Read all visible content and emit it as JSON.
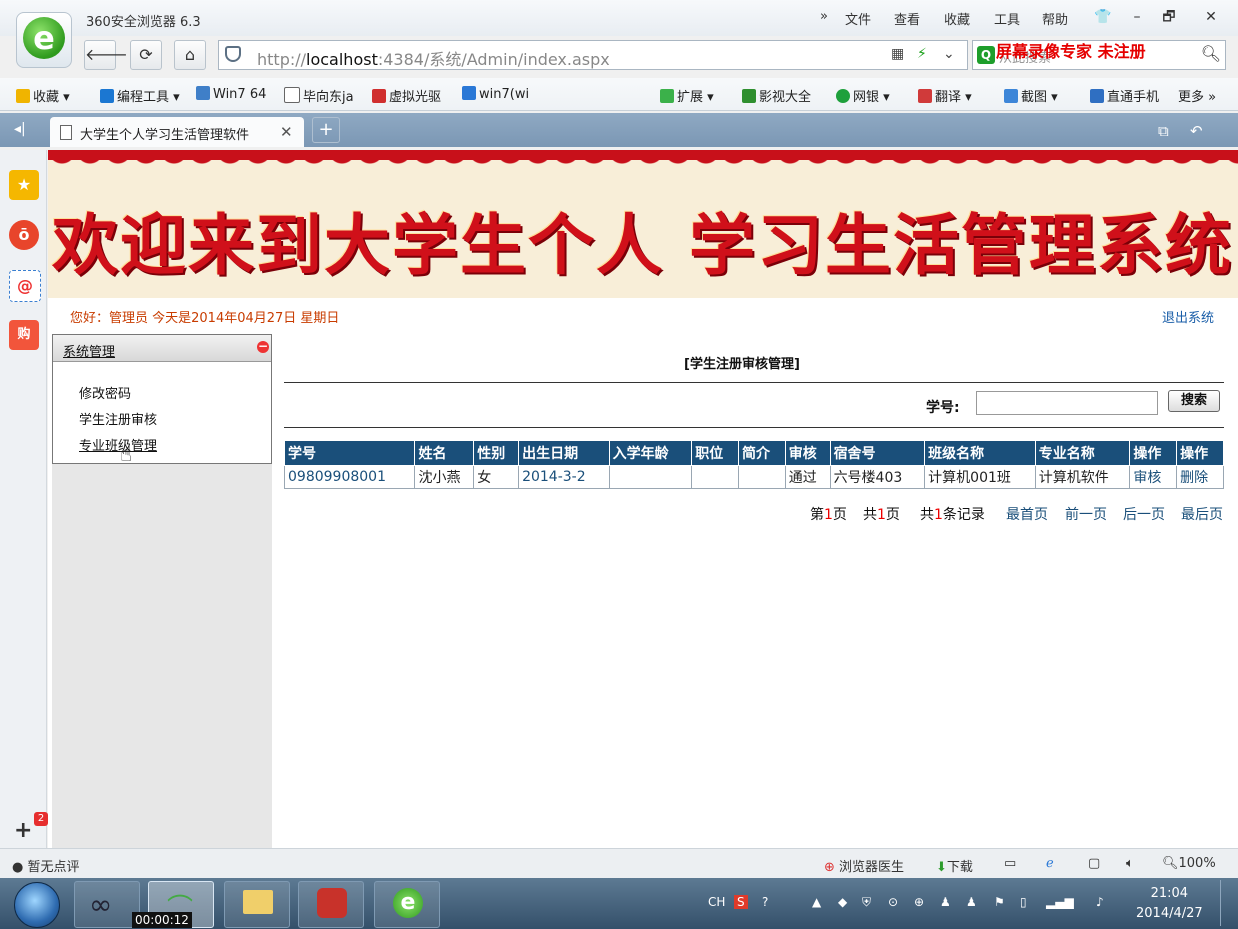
{
  "browser": {
    "title": "360安全浏览器 6.3",
    "menu": [
      "»",
      "文件",
      "查看",
      "收藏",
      "工具",
      "帮助"
    ],
    "window_controls": [
      "👕",
      "–",
      "🗗",
      "✕"
    ],
    "url_prefix": "http://",
    "url_host": "localhost",
    "url_rest": ":4384/系统/Admin/index.aspx",
    "search_placeholder": "从此搜索",
    "recorder_watermark": "屏幕录像专家  未注册",
    "favorites_left": [
      "收藏",
      "编程工具",
      "Win7 64",
      "毕向东ja",
      "虚拟光驱",
      "win7(wi"
    ],
    "favorites_right": [
      "扩展",
      "影视大全",
      "网银",
      "翻译",
      "截图",
      "直通手机",
      "更多 »"
    ],
    "tab_label": "大学生个人学习生活管理软件",
    "tab_close": "✕",
    "tab_new": "+",
    "sidebar_badge": "2",
    "status_left": "暂无点评",
    "status_right": [
      "浏览器医生",
      "下载",
      "100%"
    ]
  },
  "page": {
    "banner_text": "欢迎来到大学生个人  学习生活管理系统",
    "greeting": "您好：管理员    今天是2014年04月27日    星期日",
    "logout": "退出系统",
    "nav": {
      "title": "系统管理",
      "collapse": "−",
      "items": [
        "修改密码",
        "学生注册审核",
        "专业班级管理"
      ]
    },
    "main_title": "[学生注册审核管理]",
    "search": {
      "label": "学号:",
      "value": "",
      "button": "搜索"
    },
    "table": {
      "headers": [
        "学号",
        "姓名",
        "性别",
        "出生日期",
        "入学年龄",
        "职位",
        "简介",
        "审核",
        "宿舍号",
        "班级名称",
        "专业名称",
        "操作",
        "操作"
      ],
      "rows": [
        [
          "09809908001",
          "沈小燕",
          "女",
          "2014-3-2",
          "",
          "",
          "",
          "通过",
          "六号楼403",
          "计算机001班",
          "计算机软件",
          "审核",
          "删除"
        ]
      ]
    },
    "pager": {
      "page_prefix": "第",
      "page_num": "1",
      "page_suffix": "页",
      "total_prefix": "共",
      "total_num": "1",
      "total_suffix": "页",
      "rec_prefix": "共",
      "rec_num": "1",
      "rec_suffix": "条记录",
      "links": [
        "最首页",
        "前一页",
        "后一页",
        "最后页"
      ]
    }
  },
  "taskbar": {
    "recording_timer": "00:00:12",
    "tray_lang": "CH",
    "time": "21:04",
    "date": "2014/4/27"
  }
}
